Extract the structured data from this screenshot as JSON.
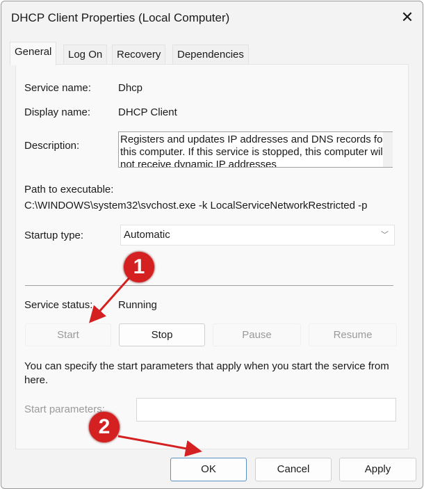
{
  "window": {
    "title": "DHCP Client Properties (Local Computer)",
    "close_icon": "close-icon"
  },
  "tabs": [
    {
      "label": "General",
      "active": true
    },
    {
      "label": "Log On"
    },
    {
      "label": "Recovery"
    },
    {
      "label": "Dependencies"
    }
  ],
  "general": {
    "service_name_label": "Service name:",
    "service_name": "Dhcp",
    "display_name_label": "Display name:",
    "display_name": "DHCP Client",
    "description_label": "Description:",
    "description": "Registers and updates IP addresses and DNS records for this computer. If this service is stopped, this computer will not receive dynamic IP addresses",
    "path_label": "Path to executable:",
    "path": "C:\\WINDOWS\\system32\\svchost.exe -k LocalServiceNetworkRestricted -p",
    "startup_type_label": "Startup type:",
    "startup_type": "Automatic",
    "service_status_label": "Service status:",
    "service_status": "Running",
    "buttons": {
      "start": "Start",
      "stop": "Stop",
      "pause": "Pause",
      "resume": "Resume"
    },
    "hint": "You can specify the start parameters that apply when you start the service from here.",
    "start_params_label": "Start parameters:",
    "start_params_value": ""
  },
  "footer": {
    "ok": "OK",
    "cancel": "Cancel",
    "apply": "Apply"
  },
  "annotations": {
    "step1": "1",
    "step2": "2",
    "color": "#d42020"
  }
}
